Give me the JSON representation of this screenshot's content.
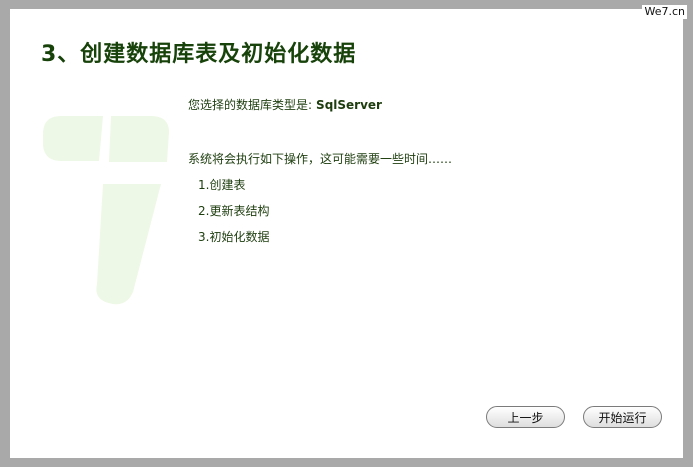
{
  "watermark": "We7.cn",
  "page_title": "3、创建数据库表及初始化数据",
  "db_type": {
    "label": "您选择的数据库类型是:",
    "value": "SqlServer"
  },
  "ops_intro": "系统将会执行如下操作，这可能需要一些时间……",
  "operations": [
    "1.创建表",
    "2.更新表结构",
    "3.初始化数据"
  ],
  "buttons": {
    "prev": "上一步",
    "start": "开始运行"
  },
  "colors": {
    "frame": "#a9a9a9",
    "title": "#17420a",
    "logo": "#eef8e6"
  },
  "logo_icon": "we7-logo-7-icon"
}
